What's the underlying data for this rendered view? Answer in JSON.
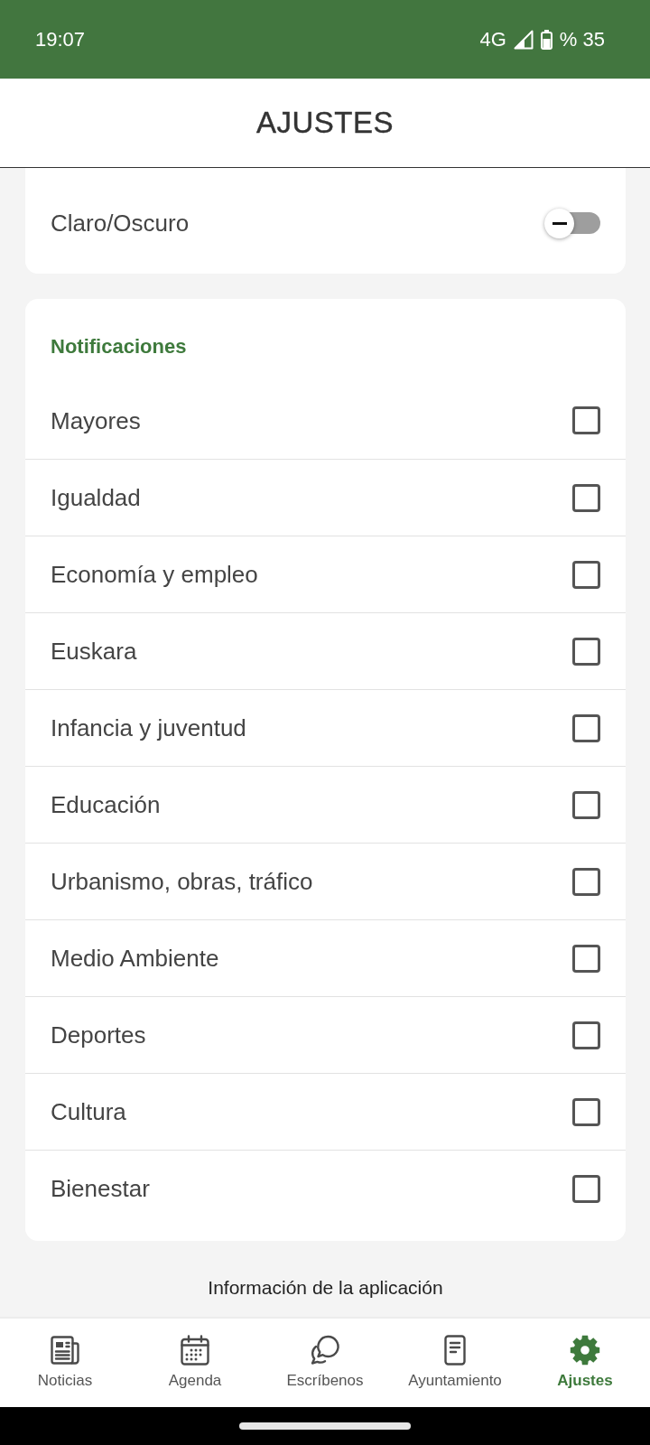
{
  "status_bar": {
    "time": "19:07",
    "network": "4G",
    "battery": "% 35"
  },
  "header": {
    "title": "AJUSTES"
  },
  "appearance": {
    "label": "Claro/Oscuro",
    "on": false
  },
  "notifications": {
    "title": "Notificaciones",
    "items": [
      {
        "label": "Mayores",
        "checked": false
      },
      {
        "label": "Igualdad",
        "checked": false
      },
      {
        "label": "Economía y empleo",
        "checked": false
      },
      {
        "label": "Euskara",
        "checked": false
      },
      {
        "label": "Infancia y juventud",
        "checked": false
      },
      {
        "label": "Educación",
        "checked": false
      },
      {
        "label": "Urbanismo, obras, tráfico",
        "checked": false
      },
      {
        "label": "Medio Ambiente",
        "checked": false
      },
      {
        "label": "Deportes",
        "checked": false
      },
      {
        "label": "Cultura",
        "checked": false
      },
      {
        "label": "Bienestar",
        "checked": false
      }
    ]
  },
  "app_info": {
    "label": "Información de la aplicación"
  },
  "bottom_nav": [
    {
      "label": "Noticias",
      "selected": false
    },
    {
      "label": "Agenda",
      "selected": false
    },
    {
      "label": "Escríbenos",
      "selected": false
    },
    {
      "label": "Ayuntamiento",
      "selected": false
    },
    {
      "label": "Ajustes",
      "selected": true
    }
  ]
}
